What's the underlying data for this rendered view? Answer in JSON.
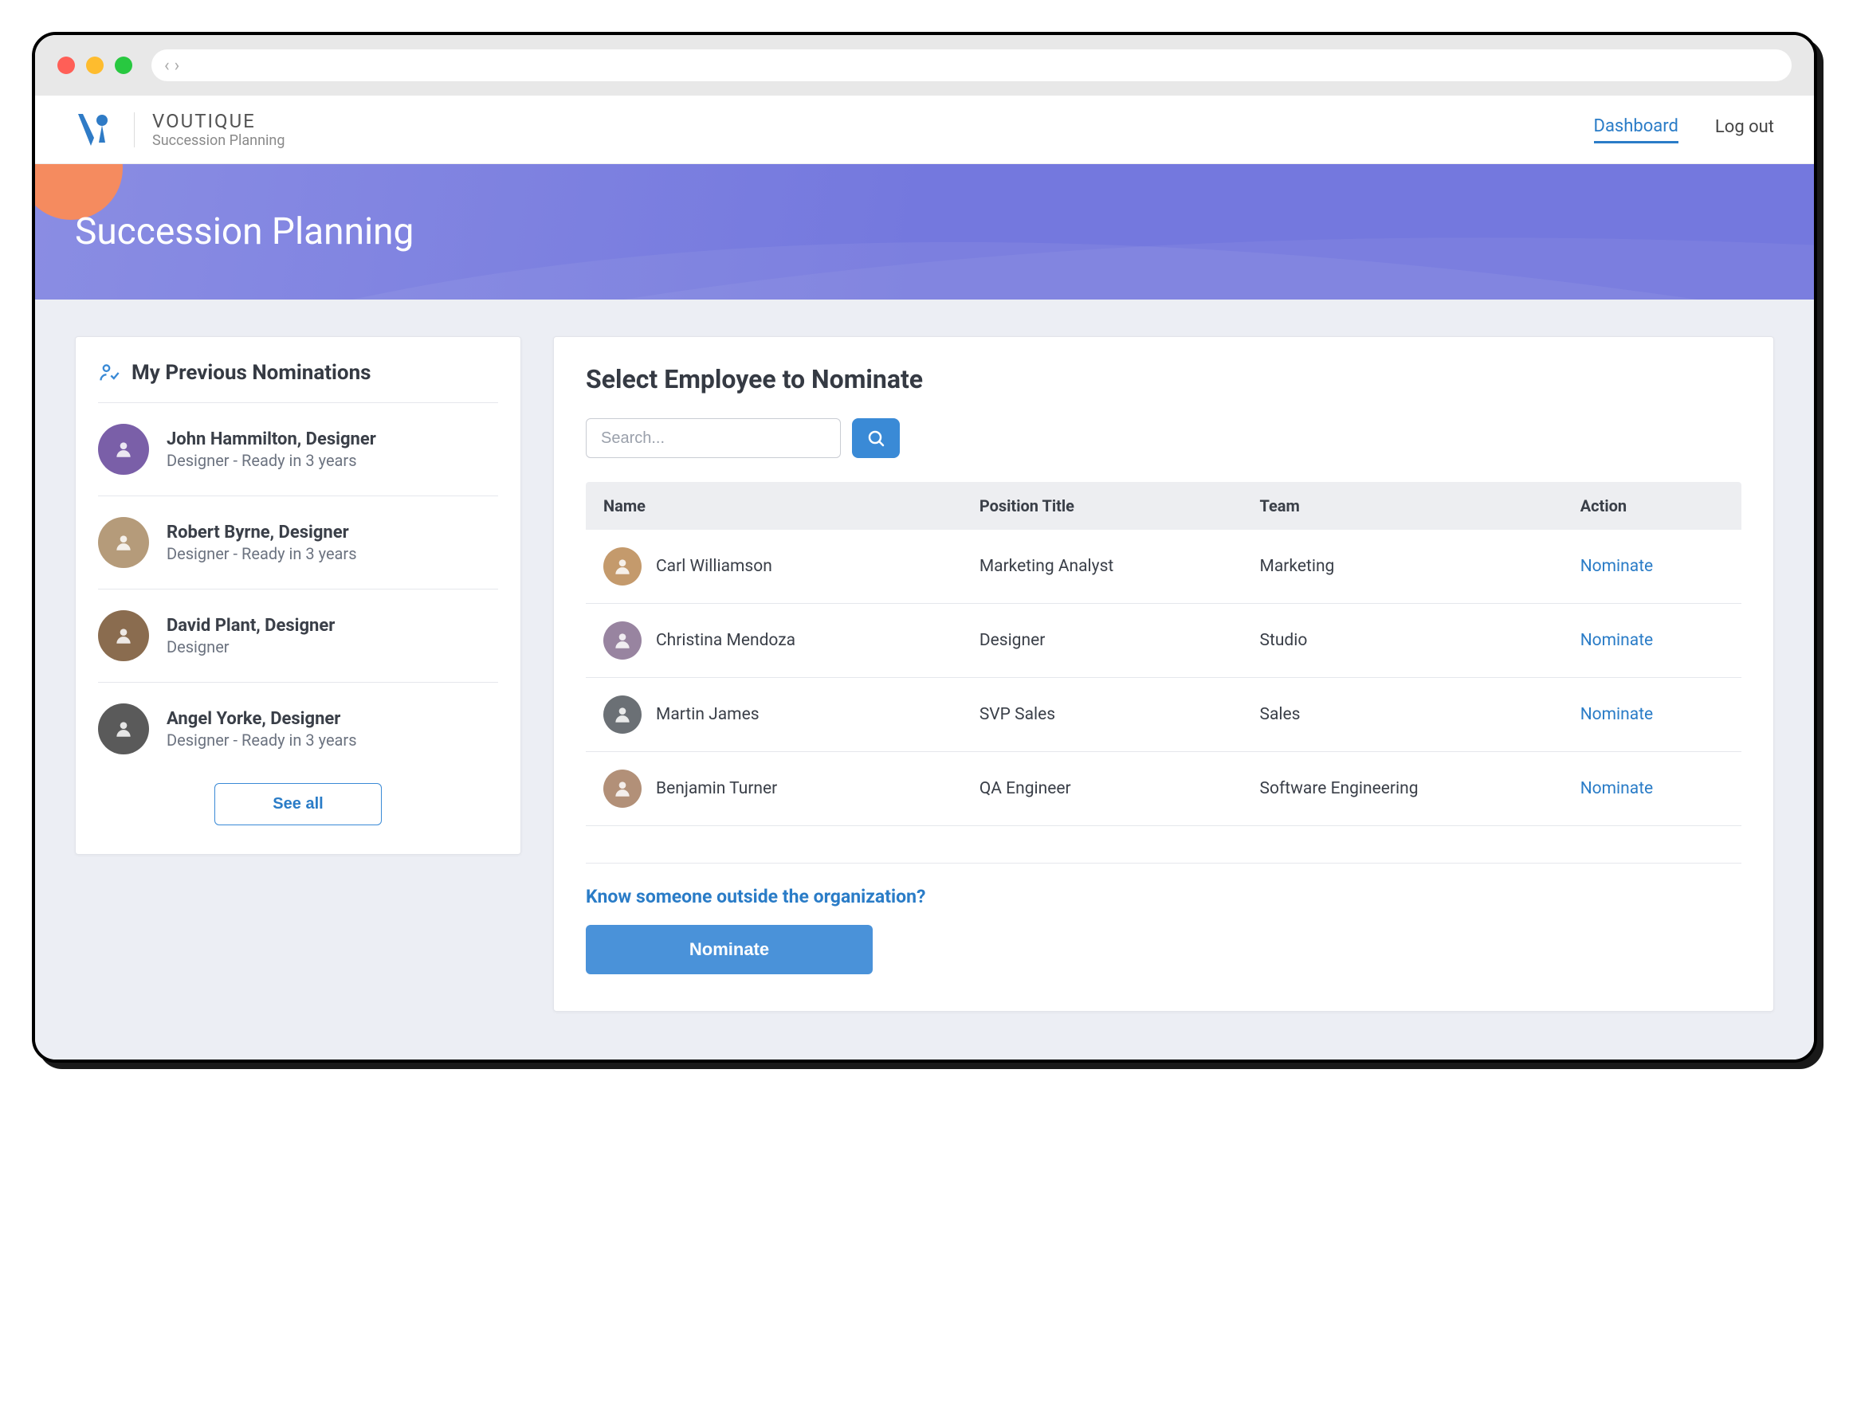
{
  "brand": {
    "name": "VOUTIQUE",
    "subtitle": "Succession Planning"
  },
  "nav": {
    "dashboard": "Dashboard",
    "logout": "Log out"
  },
  "hero": {
    "title": "Succession Planning"
  },
  "sidebar": {
    "title": "My Previous Nominations",
    "items": [
      {
        "name": "John Hammilton, Designer",
        "sub": "Designer - Ready in 3 years",
        "avatar_bg": "#7a5fa8"
      },
      {
        "name": "Robert Byrne, Designer",
        "sub": "Designer - Ready in 3 years",
        "avatar_bg": "#b59b7a"
      },
      {
        "name": "David Plant, Designer",
        "sub": "Designer",
        "avatar_bg": "#8a6c4f"
      },
      {
        "name": "Angel Yorke, Designer",
        "sub": "Designer - Ready in 3 years",
        "avatar_bg": "#5a5a5a"
      }
    ],
    "see_all": "See all"
  },
  "main": {
    "title": "Select Employee to Nominate",
    "search_placeholder": "Search...",
    "columns": {
      "name": "Name",
      "position": "Position Title",
      "team": "Team",
      "action": "Action"
    },
    "rows": [
      {
        "name": "Carl Williamson",
        "position": "Marketing Analyst",
        "team": "Marketing",
        "action": "Nominate",
        "avatar_bg": "#c49a6c"
      },
      {
        "name": "Christina Mendoza",
        "position": "Designer",
        "team": "Studio",
        "action": "Nominate",
        "avatar_bg": "#9884a0"
      },
      {
        "name": "Martin James",
        "position": "SVP Sales",
        "team": "Sales",
        "action": "Nominate",
        "avatar_bg": "#6b7075"
      },
      {
        "name": "Benjamin Turner",
        "position": "QA Engineer",
        "team": "Software Engineering",
        "action": "Nominate",
        "avatar_bg": "#b29078"
      }
    ],
    "outside_text": "Know someone outside the organization?",
    "nominate_button": "Nominate"
  }
}
